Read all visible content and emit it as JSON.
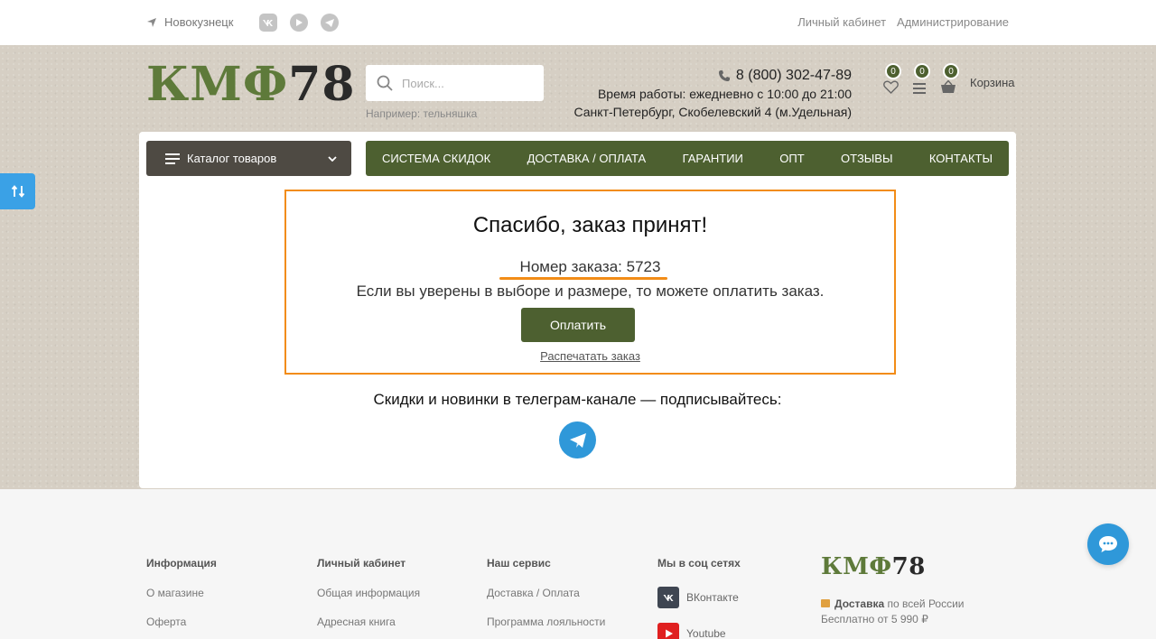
{
  "topbar": {
    "city": "Новокузнецк",
    "links": [
      "Личный кабинет",
      "Администрирование"
    ]
  },
  "header": {
    "logo_green": "КМФ",
    "logo_dark": "78",
    "search_placeholder": "Поиск...",
    "search_hint_prefix": "Например:",
    "search_hint_example": "тельняшка",
    "phone": "8 (800) 302-47-89",
    "hours": "Время работы: ежедневно с 10:00 до 21:00",
    "address": "Санкт-Петербург, Скобелевский 4 (м.Удельная)",
    "favorites_count": "0",
    "compare_count": "0",
    "cart_count": "0",
    "cart_label": "Корзина"
  },
  "nav": {
    "catalog_label": "Каталог товаров",
    "items": [
      "СИСТЕМА СКИДОК",
      "ДОСТАВКА / ОПЛАТА",
      "ГАРАНТИИ",
      "ОПТ",
      "ОТЗЫВЫ",
      "КОНТАКТЫ"
    ]
  },
  "order": {
    "title": "Спасибо, заказ принят!",
    "number_text": "Номер заказа: 5723",
    "note": "Если вы уверены в выборе и размере, то можете оплатить заказ.",
    "pay_button": "Оплатить",
    "print_link": "Распечатать заказ"
  },
  "telegram": {
    "text": "Скидки и новинки в телеграм-канале — подписывайтесь:"
  },
  "footer": {
    "col1": {
      "title": "Информация",
      "links": [
        "О магазине",
        "Оферта"
      ]
    },
    "col2": {
      "title": "Личный кабинет",
      "links": [
        "Общая информация",
        "Адресная книга"
      ]
    },
    "col3": {
      "title": "Наш сервис",
      "links": [
        "Доставка / Оплата",
        "Программа лояльности"
      ]
    },
    "col4": {
      "title": "Мы в соц сетях",
      "links": [
        "ВКонтакте",
        "Youtube"
      ]
    },
    "logo_green": "КМФ",
    "logo_dark": "78",
    "delivery_bold": "Доставка",
    "delivery_rest": "по всей России",
    "free_from": "Бесплатно от 5 990 ₽"
  },
  "colors": {
    "brand_green": "#4d6030",
    "accent_orange": "#f28c17",
    "telegram_blue": "#2f98d9"
  }
}
